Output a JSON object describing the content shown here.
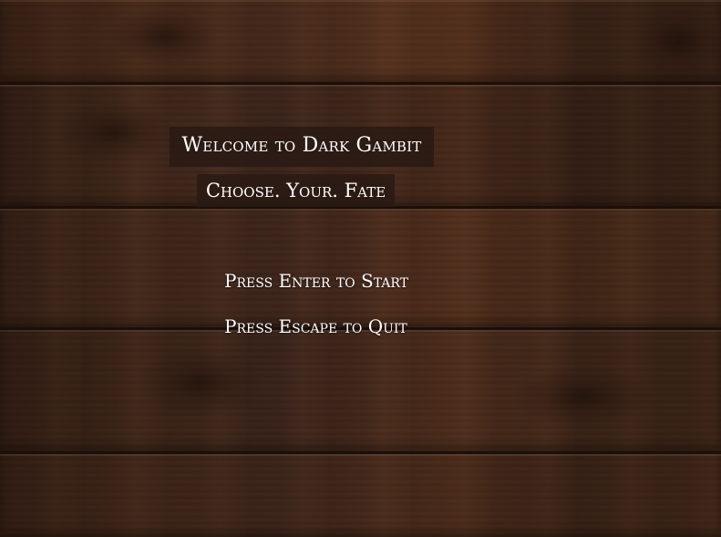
{
  "game": {
    "title": "Welcome to Dark Gambit",
    "tagline": "Choose. Your. Fate",
    "start_prompt": "Press Enter to Start",
    "quit_prompt": "Press Escape to Quit"
  },
  "theme": {
    "background": "wood-planks",
    "text_color": "#ffffff",
    "box_color": "#281a14"
  }
}
